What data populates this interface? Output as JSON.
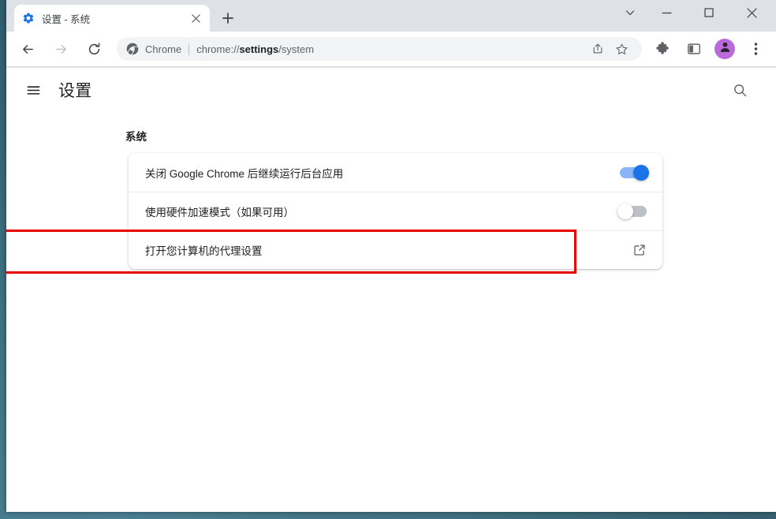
{
  "window": {
    "controls": {
      "tab_search": "chevron-down",
      "minimize": "minimize",
      "maximize": "maximize",
      "close": "close"
    }
  },
  "tabstrip": {
    "tabs": [
      {
        "title": "设置 - 系统",
        "favicon": "gear-icon",
        "active": true,
        "close_label": "×"
      }
    ],
    "new_tab_label": "+"
  },
  "toolbar": {
    "back_label": "←",
    "forward_label": "→",
    "reload_label": "⟳",
    "omnibox": {
      "icon": "chrome-icon",
      "scheme_label": "Chrome",
      "url_prefix": "chrome://",
      "url_bold": "settings",
      "url_suffix": "/system",
      "full_url": "chrome://settings/system",
      "share_icon": "share-icon",
      "bookmark_icon": "star-icon"
    },
    "extensions_icon": "puzzle-piece-icon",
    "side_panel_icon": "side-panel-icon",
    "avatar_icon": "person-avatar-icon",
    "avatar_color": "#bb6bd9",
    "menu_icon": "three-dot-menu-icon"
  },
  "settings": {
    "menu_icon": "hamburger-menu-icon",
    "title": "设置",
    "search_icon": "search-icon",
    "section_title": "系统",
    "rows": [
      {
        "label": "关闭 Google Chrome 后继续运行后台应用",
        "control": "toggle",
        "state": "on"
      },
      {
        "label": "使用硬件加速模式（如果可用）",
        "control": "toggle",
        "state": "off"
      },
      {
        "label": "打开您计算机的代理设置",
        "control": "external-link",
        "highlighted": true
      }
    ]
  },
  "annotation": {
    "highlight_color": "#e60000"
  }
}
